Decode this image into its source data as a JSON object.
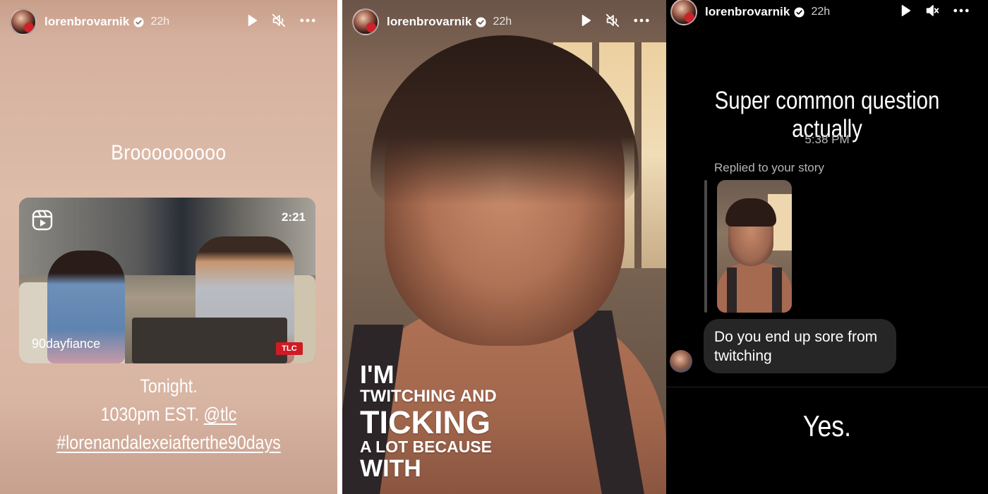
{
  "stories": [
    {
      "username": "lorenbrovarnik",
      "time": "22h",
      "heading": "Brooooooooo",
      "reel": {
        "duration": "2:21",
        "caption": "90dayfiance",
        "badge": "TLC"
      },
      "lines": [
        "Tonight.",
        "1030pm EST.",
        "@tlc",
        "#lorenandalexeiafterthe90days"
      ]
    },
    {
      "username": "lorenbrovarnik",
      "time": "22h",
      "overlay": [
        "I'M",
        "TWITCHING AND",
        "TICKING",
        "A LOT BECAUSE",
        "WITH"
      ]
    },
    {
      "username": "lorenbrovarnik",
      "time": "22h",
      "heading": "Super common question actually",
      "timestamp": "5:38 PM",
      "replied_label": "Replied to your story",
      "message": "Do you end up sore from twitching",
      "answer": "Yes."
    }
  ],
  "colors": {
    "panel1_bg": "#d6b09e",
    "panel3_bg": "#000000",
    "bubble_bg": "#262626",
    "tlc_red": "#d01a24"
  },
  "icons": [
    "verified-icon",
    "play-icon",
    "mute-icon",
    "more-icon",
    "reel-icon"
  ]
}
